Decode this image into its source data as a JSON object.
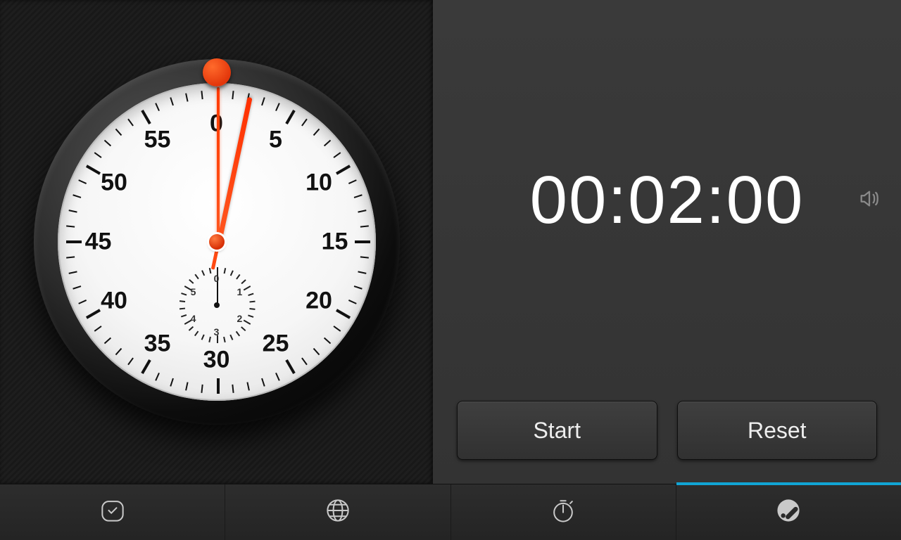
{
  "timer": {
    "display": "00:02:00",
    "start_label": "Start",
    "reset_label": "Reset"
  },
  "dial": {
    "numerals": [
      "0",
      "5",
      "10",
      "15",
      "20",
      "25",
      "30",
      "35",
      "40",
      "45",
      "50",
      "55"
    ],
    "sub_numerals": [
      "0",
      "1",
      "2",
      "3",
      "4",
      "5"
    ],
    "minute_hand_angle_deg": 12,
    "second_hand_angle_deg": 0,
    "sub_hand_angle_deg": 0
  },
  "tabs": {
    "items": [
      "alarm",
      "world-clock",
      "stopwatch",
      "timer"
    ],
    "active_index": 3
  },
  "colors": {
    "accent": "#ff4a12",
    "active_tab": "#11a4d4"
  }
}
